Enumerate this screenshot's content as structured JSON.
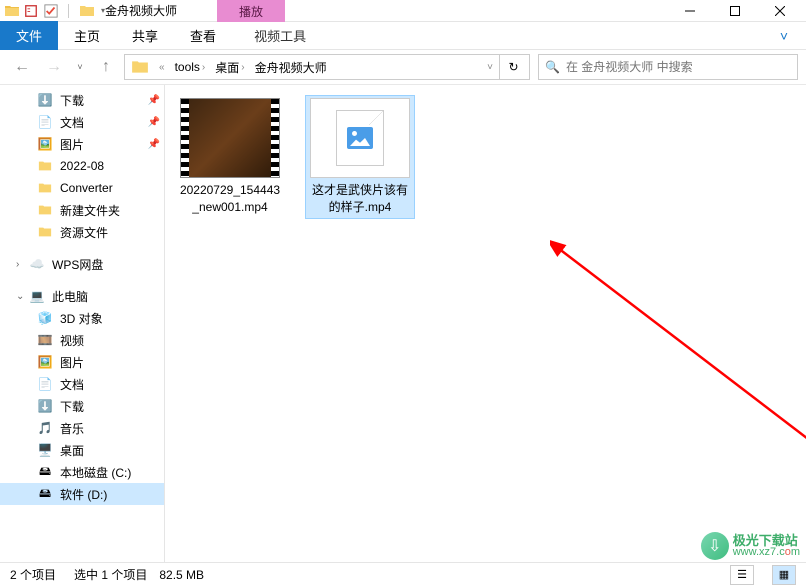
{
  "titlebar": {
    "app_title": "金舟视频大师"
  },
  "contextual_tab": {
    "header": "播放",
    "tab": "视频工具"
  },
  "ribbon": {
    "file": "文件",
    "tabs": [
      "主页",
      "共享",
      "查看"
    ]
  },
  "breadcrumb": {
    "items": [
      "tools",
      "桌面",
      "金舟视频大师"
    ]
  },
  "search": {
    "placeholder": "在 金舟视频大师 中搜索"
  },
  "sidebar": {
    "quick": [
      {
        "label": "下载",
        "icon": "download",
        "pinned": true
      },
      {
        "label": "文档",
        "icon": "doc",
        "pinned": true
      },
      {
        "label": "图片",
        "icon": "picture",
        "pinned": true
      },
      {
        "label": "2022-08",
        "icon": "folder"
      },
      {
        "label": "Converter",
        "icon": "folder"
      },
      {
        "label": "新建文件夹",
        "icon": "folder"
      },
      {
        "label": "资源文件",
        "icon": "folder"
      }
    ],
    "wps": "WPS网盘",
    "thispc": "此电脑",
    "pc_children": [
      {
        "label": "3D 对象",
        "icon": "3d"
      },
      {
        "label": "视频",
        "icon": "video"
      },
      {
        "label": "图片",
        "icon": "picture"
      },
      {
        "label": "文档",
        "icon": "doc"
      },
      {
        "label": "下载",
        "icon": "download"
      },
      {
        "label": "音乐",
        "icon": "music"
      },
      {
        "label": "桌面",
        "icon": "desktop"
      },
      {
        "label": "本地磁盘 (C:)",
        "icon": "drive"
      },
      {
        "label": "软件 (D:)",
        "icon": "drive",
        "selected": true
      }
    ]
  },
  "files": [
    {
      "name": "20220729_154443_new001.mp4",
      "type": "video"
    },
    {
      "name": "这才是武侠片该有的样子.mp4",
      "type": "generic",
      "selected": true
    }
  ],
  "statusbar": {
    "count": "2 个项目",
    "selection": "选中 1 个项目　82.5 MB"
  },
  "watermark": {
    "cn": "极光下载站",
    "url_prefix": "www.xz7.c",
    "url_suffix": "m"
  }
}
